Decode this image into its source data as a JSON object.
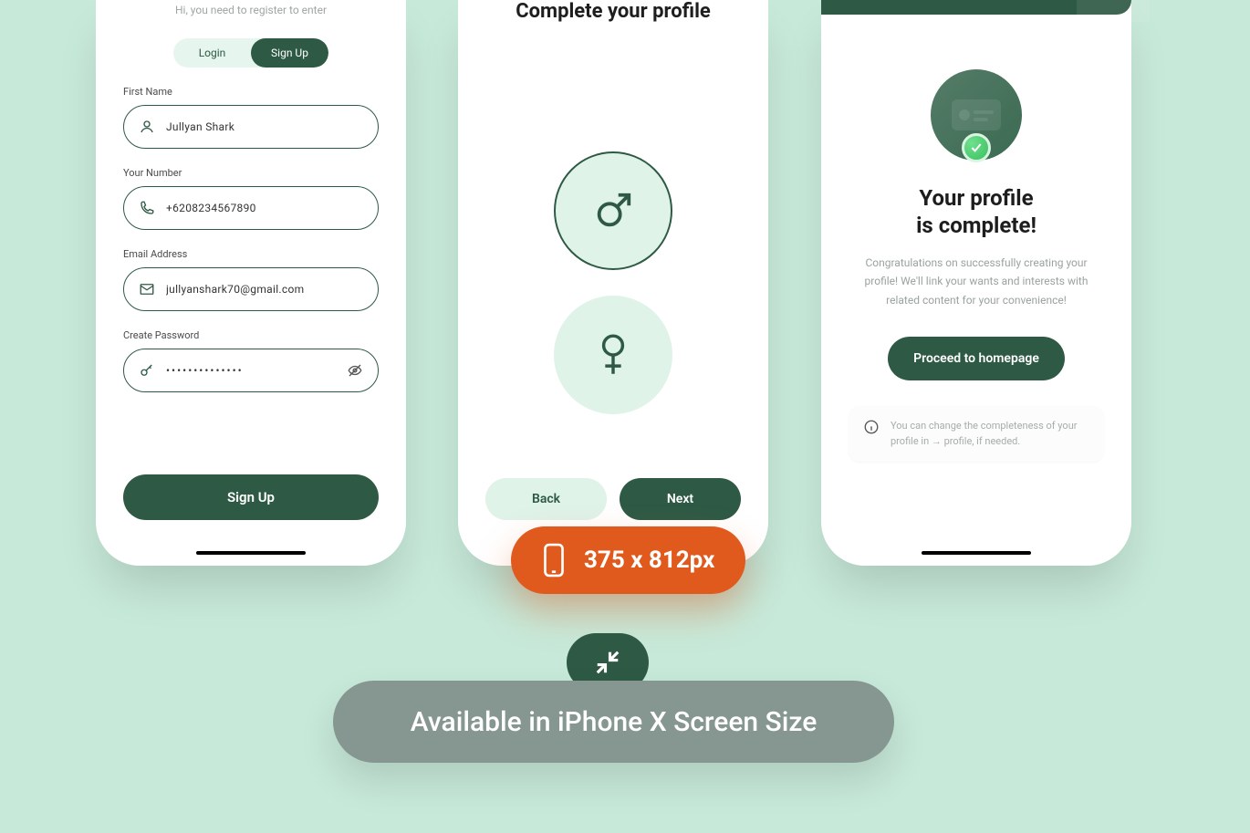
{
  "screen1": {
    "subtitle": "Hi, you need to register to enter",
    "tabs": {
      "login": "Login",
      "signup": "Sign Up"
    },
    "fields": {
      "first_name": {
        "label": "First Name",
        "value": "Jullyan Shark"
      },
      "number": {
        "label": "Your Number",
        "value": "+6208234567890"
      },
      "email": {
        "label": "Email Address",
        "value": "jullyanshark70@gmail.com"
      },
      "password": {
        "label": "Create Password",
        "value": "••••••••••••••"
      }
    },
    "submit": "Sign Up"
  },
  "screen2": {
    "title": "Complete your profile",
    "back": "Back",
    "next": "Next"
  },
  "screen3": {
    "title_line1": "Your profile",
    "title_line2": "is complete!",
    "desc": "Congratulations on successfully creating your profile! We'll link your wants and interests with related content for your convenience!",
    "proceed": "Proceed to homepage",
    "info": "You can change the completeness of your profile in → profile, if needed."
  },
  "overlay": {
    "dimensions": "375 x 812px",
    "footer": "Available in iPhone X Screen Size"
  }
}
